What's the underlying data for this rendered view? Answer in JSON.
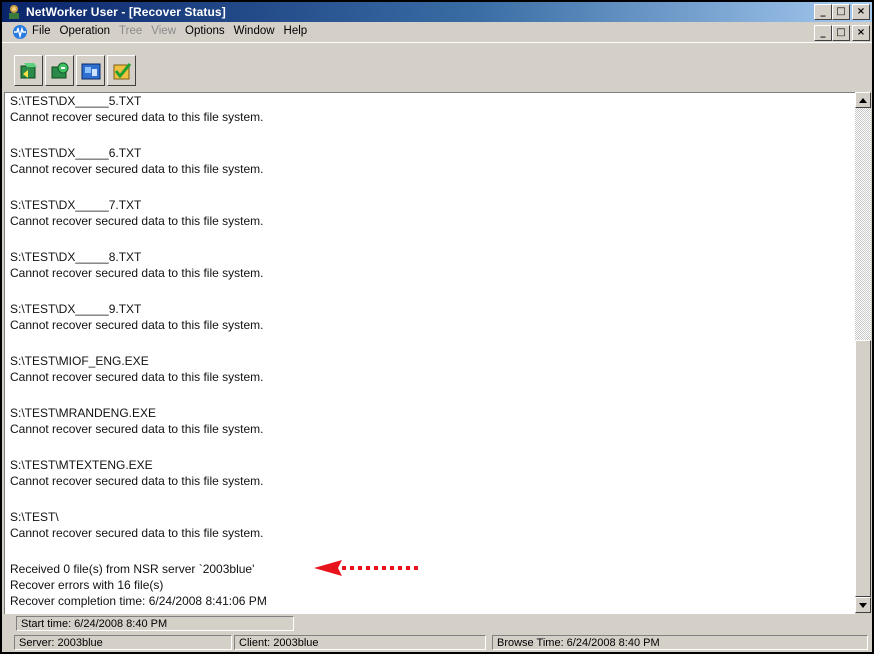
{
  "window": {
    "title": "NetWorker User - [Recover Status]",
    "caption_buttons": [
      "_",
      "□",
      "×"
    ]
  },
  "menubar": {
    "items": [
      {
        "label": "File",
        "enabled": true
      },
      {
        "label": "Operation",
        "enabled": true
      },
      {
        "label": "Tree",
        "enabled": false
      },
      {
        "label": "View",
        "enabled": false
      },
      {
        "label": "Options",
        "enabled": true
      },
      {
        "label": "Window",
        "enabled": true
      },
      {
        "label": "Help",
        "enabled": true
      }
    ]
  },
  "toolbar": {
    "buttons": [
      "recover-start-icon",
      "recover-stop-icon",
      "browse-icon",
      "mark-icon"
    ]
  },
  "log": {
    "entries": [
      {
        "file": "S:\\TEST\\DX_____5.TXT",
        "message": "Cannot recover secured data to this file system."
      },
      {
        "file": "S:\\TEST\\DX_____6.TXT",
        "message": "Cannot recover secured data to this file system."
      },
      {
        "file": "S:\\TEST\\DX_____7.TXT",
        "message": "Cannot recover secured data to this file system."
      },
      {
        "file": "S:\\TEST\\DX_____8.TXT",
        "message": "Cannot recover secured data to this file system."
      },
      {
        "file": "S:\\TEST\\DX_____9.TXT",
        "message": "Cannot recover secured data to this file system."
      },
      {
        "file": "S:\\TEST\\MIOF_ENG.EXE",
        "message": "Cannot recover secured data to this file system."
      },
      {
        "file": "S:\\TEST\\MRANDENG.EXE",
        "message": "Cannot recover secured data to this file system."
      },
      {
        "file": "S:\\TEST\\MTEXTENG.EXE",
        "message": "Cannot recover secured data to this file system."
      },
      {
        "file": "S:\\TEST\\",
        "message": "Cannot recover secured data to this file system."
      }
    ],
    "summary": [
      "Received 0 file(s) from NSR server `2003blue'",
      "Recover errors with 16 file(s)",
      "Recover completion time: 6/24/2008 8:41:06 PM"
    ]
  },
  "statusbar": {
    "start_time": "Start time: 6/24/2008 8:40 PM",
    "server": "Server: 2003blue",
    "client": "Client: 2003blue",
    "browse_time": "Browse Time: 6/24/2008 8:40 PM"
  },
  "colors": {
    "title_active": "#0a246a",
    "annotation_arrow": "#e8141c",
    "chrome": "#d4d0c8"
  }
}
